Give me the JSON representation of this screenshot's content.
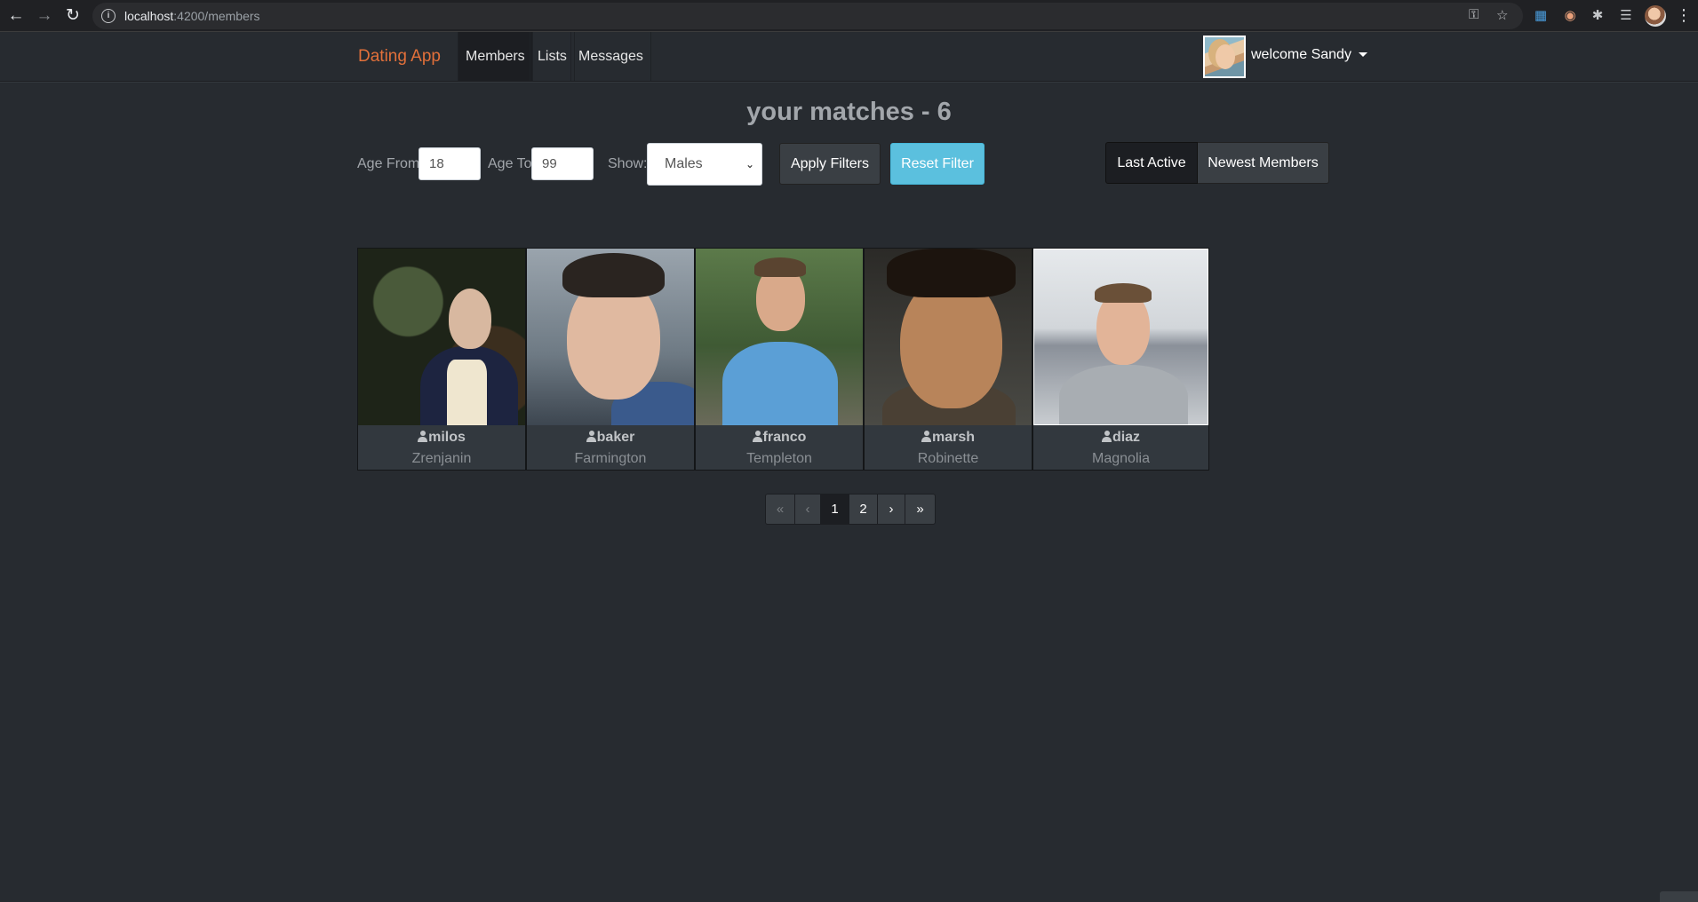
{
  "browser": {
    "url_host": "localhost",
    "url_rest": ":4200/members",
    "back_icon": "arrow-left-icon",
    "forward_icon": "arrow-right-icon",
    "reload_icon": "reload-icon"
  },
  "navbar": {
    "brand": "Dating App",
    "links": [
      "Members",
      "Lists",
      "Messages"
    ],
    "active_link": "Members",
    "welcome": "welcome Sandy"
  },
  "page": {
    "heading": "your matches - 6"
  },
  "filters": {
    "age_from_label": "Age From",
    "age_from_value": "18",
    "age_to_label": "Age To",
    "age_to_value": "99",
    "show_label": "Show:",
    "show_value": "Males",
    "apply_label": "Apply Filters",
    "reset_label": "Reset Filter",
    "sort_last_active": "Last Active",
    "sort_newest": "Newest Members"
  },
  "members": [
    {
      "username": "milos",
      "city": "Zrenjanin"
    },
    {
      "username": "baker",
      "city": "Farmington"
    },
    {
      "username": "franco",
      "city": "Templeton"
    },
    {
      "username": "marsh",
      "city": "Robinette"
    },
    {
      "username": "diaz",
      "city": "Magnolia"
    }
  ],
  "pagination": {
    "first": "«",
    "prev": "‹",
    "pages": [
      "1",
      "2"
    ],
    "current": "1",
    "next": "›",
    "last": "»"
  },
  "colors": {
    "background": "#272b30",
    "brand": "#e2703a",
    "info_button": "#5bc0de",
    "card": "#32383e"
  }
}
